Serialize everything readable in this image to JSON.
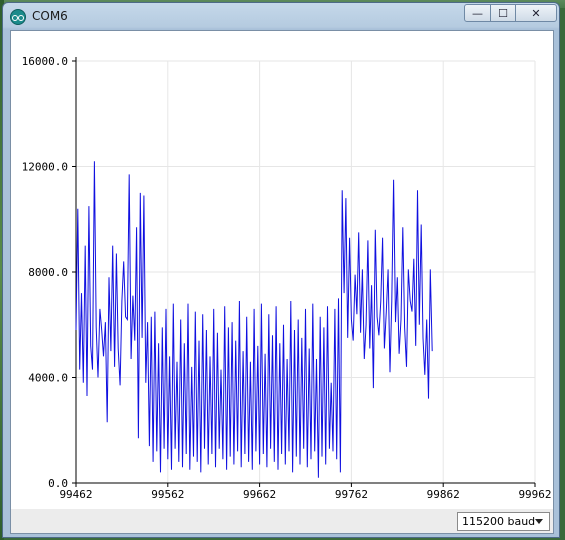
{
  "window": {
    "title": "COM6"
  },
  "controls": {
    "minimize": "—",
    "maximize": "☐",
    "close": "✕"
  },
  "status": {
    "baud_selected": "115200 baud"
  },
  "colors": {
    "line": "#1010e0",
    "grid": "#e6e6e6"
  },
  "chart_data": {
    "type": "line",
    "title": "",
    "xlabel": "",
    "ylabel": "",
    "xlim": [
      99462,
      99962
    ],
    "ylim": [
      0,
      16000
    ],
    "x_ticks": [
      "99462",
      "99562",
      "99662",
      "99762",
      "99862",
      "99962"
    ],
    "y_ticks": [
      "0.0",
      "4000.0",
      "8000.0",
      "12000.0",
      "16000.0"
    ],
    "grid": true,
    "series": [
      {
        "x_start": 99462,
        "x_step": 2,
        "values": [
          5800,
          10400,
          4300,
          7200,
          3800,
          9000,
          3300,
          10500,
          5200,
          4300,
          12200,
          5900,
          4000,
          6600,
          5800,
          4800,
          6100,
          2300,
          7800,
          5000,
          9000,
          4400,
          8700,
          5100,
          3700,
          6900,
          8400,
          6300,
          6200,
          11700,
          4700,
          7100,
          5400,
          9700,
          1700,
          11000,
          5500,
          10900,
          3800,
          6100,
          1400,
          6300,
          800,
          6500,
          1200,
          5300,
          400,
          5900,
          1300,
          6600,
          900,
          4800,
          500,
          6800,
          1300,
          4600,
          800,
          6200,
          600,
          5300,
          1100,
          6800,
          500,
          4400,
          1000,
          6500,
          800,
          5400,
          400,
          6400,
          1300,
          5800,
          700,
          4800,
          1100,
          6600,
          600,
          5700,
          1300,
          4300,
          900,
          6700,
          500,
          5900,
          1000,
          6100,
          700,
          5400,
          1200,
          6900,
          600,
          5000,
          1100,
          6300,
          800,
          4600,
          500,
          6600,
          1200,
          5200,
          700,
          6800,
          1100,
          4900,
          600,
          6400,
          1300,
          5600,
          800,
          6700,
          500,
          5300,
          1100,
          6000,
          700,
          4700,
          1200,
          6900,
          400,
          5800,
          1000,
          6200,
          700,
          5500,
          1300,
          6600,
          600,
          5100,
          900,
          6800,
          1200,
          4700,
          200,
          6300,
          1000,
          5900,
          700,
          6700,
          1300,
          3800,
          1200,
          6600,
          900,
          7000,
          400,
          11100,
          7200,
          10800,
          5500,
          9300,
          6200,
          5400,
          7900,
          6400,
          9500,
          5700,
          8100,
          4700,
          6000,
          9200,
          5100,
          7500,
          3600,
          9600,
          6300,
          5600,
          6900,
          9300,
          5100,
          6500,
          8100,
          4200,
          6900,
          11500,
          6100,
          7800,
          4900,
          6200,
          9700,
          5900,
          4400,
          8100,
          6900,
          6500,
          8500,
          5200,
          11100,
          6000,
          9800,
          5500,
          4100,
          6200,
          3200,
          8100,
          5000
        ]
      }
    ]
  }
}
